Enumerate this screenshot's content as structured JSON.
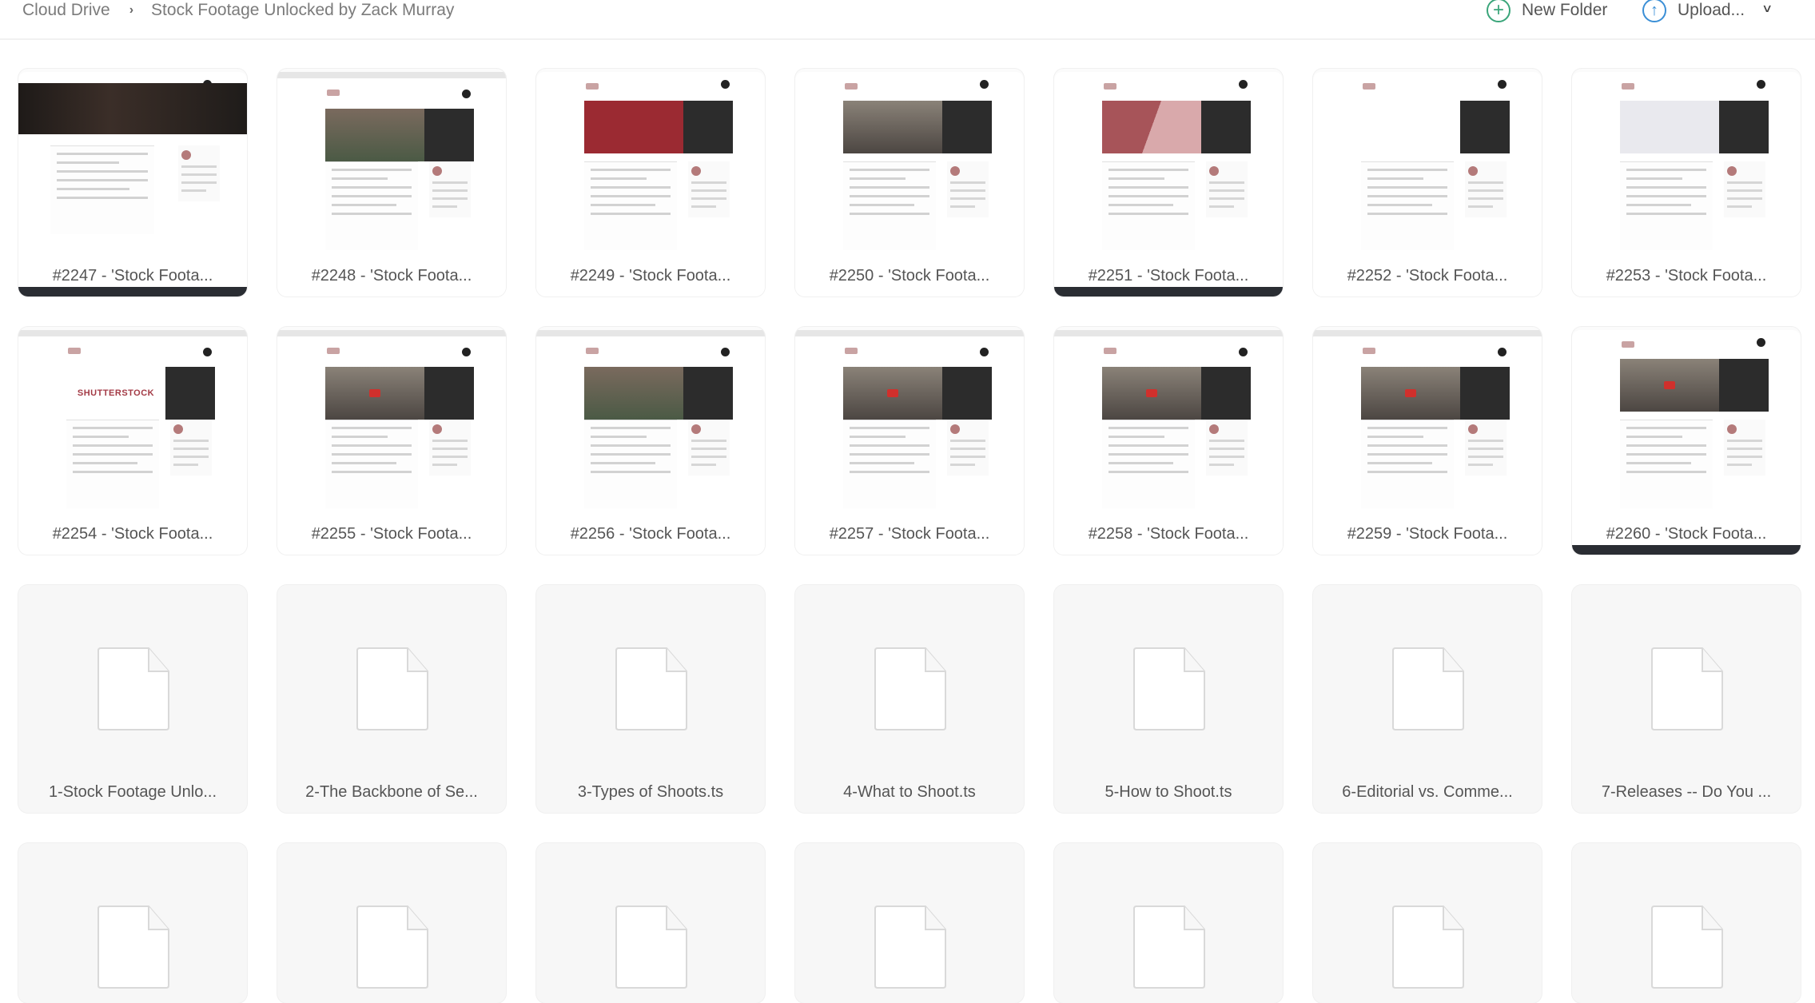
{
  "header": {
    "breadcrumb": [
      {
        "label": "Cloud Drive"
      },
      {
        "label": "Stock Footage Unlocked by Zack Murray"
      }
    ],
    "separator_icon": "chevron-right-icon",
    "new_folder_label": "New Folder",
    "new_folder_icon": "plus-circle-icon",
    "upload_label": "Upload...",
    "upload_icon": "arrow-up-circle-icon",
    "upload_menu_icon": "chevron-down-icon"
  },
  "colors": {
    "new_folder_accent": "#3aa57a",
    "upload_accent": "#3b8fd6",
    "text": "#555555"
  },
  "thumbnails": [
    {
      "label": "#2247 - 'Stock Foota...",
      "style": "banner"
    },
    {
      "label": "#2248 - 'Stock Foota...",
      "style": "grad-img"
    },
    {
      "label": "#2249 - 'Stock Foota...",
      "style": "maroon"
    },
    {
      "label": "#2250 - 'Stock Foota...",
      "style": "person"
    },
    {
      "label": "#2251 - 'Stock Foota...",
      "style": "grad"
    },
    {
      "label": "#2252 - 'Stock Foota...",
      "style": "edit"
    },
    {
      "label": "#2253 - 'Stock Foota...",
      "style": "screen"
    },
    {
      "label": "#2254 - 'Stock Foota...",
      "style": "white",
      "hero_text": "SHUTTERSTOCK"
    },
    {
      "label": "#2255 - 'Stock Foota...",
      "style": "person"
    },
    {
      "label": "#2256 - 'Stock Foota...",
      "style": "grad-img"
    },
    {
      "label": "#2257 - 'Stock Foota...",
      "style": "person"
    },
    {
      "label": "#2258 - 'Stock Foota...",
      "style": "person"
    },
    {
      "label": "#2259 - 'Stock Foota...",
      "style": "person"
    },
    {
      "label": "#2260 - 'Stock Foota...",
      "style": "person"
    }
  ],
  "files": [
    {
      "label": "1-Stock Footage Unlo..."
    },
    {
      "label": "2-The Backbone of Se..."
    },
    {
      "label": "3-Types of Shoots.ts"
    },
    {
      "label": "4-What to Shoot.ts"
    },
    {
      "label": "5-How to Shoot.ts"
    },
    {
      "label": "6-Editorial vs. Comme..."
    },
    {
      "label": "7-Releases -- Do You ..."
    }
  ],
  "partial_row_count": 7
}
